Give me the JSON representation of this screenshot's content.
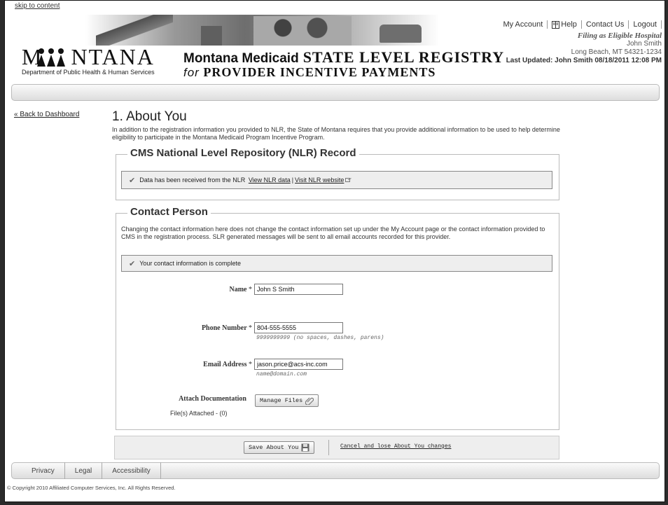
{
  "skip_link": "skip to content",
  "header": {
    "logo_text": "M    NTANA",
    "logo_dept": "Department of Public Health & Human Services",
    "title_prefix": "Montana Medicaid",
    "title_main": "STATE LEVEL REGISTRY",
    "title_for": "for",
    "title_sub": "PROVIDER INCENTIVE PAYMENTS"
  },
  "topnav": {
    "my_account": "My Account",
    "help": "Help",
    "contact_us": "Contact Us",
    "logout": "Logout"
  },
  "user": {
    "filing": "Filing as Eligible Hospital",
    "name": "John Smith",
    "location": "Long Beach, MT 54321-1234",
    "last_updated": "Last Updated: John Smith 08/18/2011 12:08 PM"
  },
  "back_link": "« Back to Dashboard",
  "page": {
    "title": "1. About You",
    "intro": "In addition to the registration information you provided to NLR, the State of Montana requires that you provide additional information to be used to help determine eligibility to participate in the Montana Medicaid Program Incentive Program."
  },
  "nlr": {
    "legend": "CMS National Level Repository (NLR) Record",
    "message": "Data has been received from the NLR",
    "view_link": "View NLR data",
    "separator": "|",
    "website_link": "Visit NLR website"
  },
  "contact": {
    "legend": "Contact Person",
    "description": "Changing the contact information here does not change the contact information set up under the My Account page or the contact information provided to CMS in the registration process. SLR generated messages will be sent to all email accounts recorded for this provider.",
    "status": "Your contact information is complete",
    "name_label": "Name",
    "name_value": "John S Smith",
    "phone_label": "Phone Number",
    "phone_value": "804-555-5555",
    "phone_hint": "9999999999 (no spaces, dashes, parens)",
    "email_label": "Email Address",
    "email_value": "jason.price@acs-inc.com",
    "email_hint": "name@domain.com",
    "required_marker": "*",
    "attach_label": "Attach Documentation",
    "manage_files": "Manage Files",
    "files_attached": "File(s) Attached - (0)"
  },
  "actions": {
    "save": "Save About You",
    "cancel": "Cancel and lose About You changes"
  },
  "footer": {
    "privacy": "Privacy",
    "legal": "Legal",
    "accessibility": "Accessibility",
    "copyright": "© Copyright 2010 Affiliated Computer Services, Inc. All Rights Reserved."
  }
}
